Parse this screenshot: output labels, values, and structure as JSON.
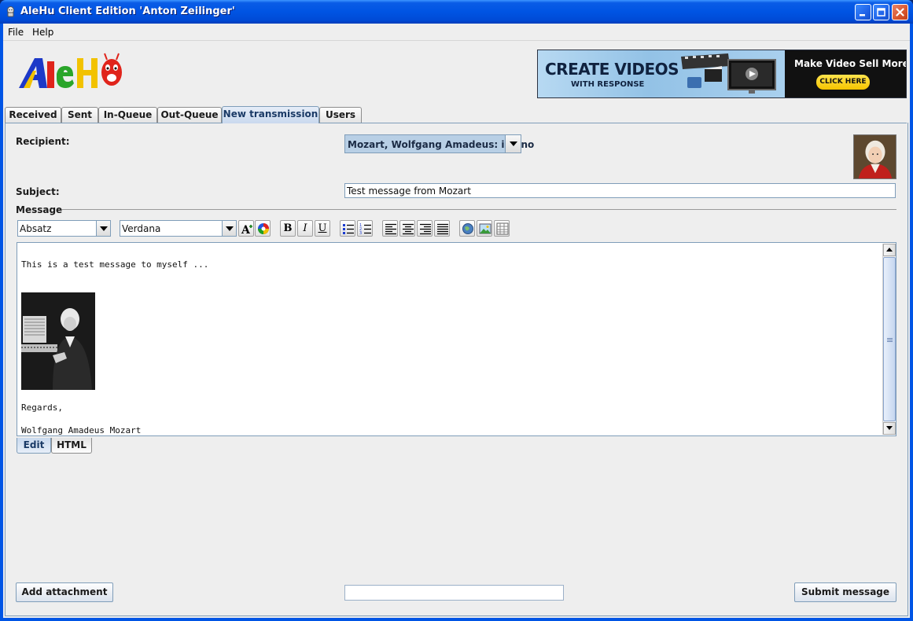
{
  "window": {
    "title": "AleHu Client Edition 'Anton Zeilinger'"
  },
  "menu": {
    "items": [
      "File",
      "Help"
    ]
  },
  "banner": {
    "headline": "CREATE VIDEOS",
    "subline": "WITH RESPONSE",
    "right_text": "Make Video Sell More",
    "cta": "CLICK HERE"
  },
  "tabs": [
    "Received",
    "Sent",
    "In-Queue",
    "Out-Queue",
    "New transmission",
    "Users"
  ],
  "active_tab": "New transmission",
  "form": {
    "recipient_label": "Recipient:",
    "recipient_value": "Mozart, Wolfgang Amadeus: iPiano",
    "subject_label": "Subject:",
    "subject_value": "Test message from Mozart",
    "message_label": "Message"
  },
  "toolbar": {
    "paragraph_style": "Absatz",
    "font_family": "Verdana",
    "bold_glyph": "B",
    "italic_glyph": "I",
    "underline_glyph": "U"
  },
  "editor": {
    "line1": "This is a test message to myself ...",
    "line2": "Regards,",
    "line3": "Wolfgang Amadeus Mozart"
  },
  "editor_tabs": [
    "Edit",
    "HTML"
  ],
  "buttons": {
    "add_attachment": "Add attachment",
    "submit": "Submit message"
  },
  "colors": {
    "titlebar": "#0054e3",
    "accent_border": "#7f9db9",
    "selected_combo": "#b8cfe5"
  }
}
